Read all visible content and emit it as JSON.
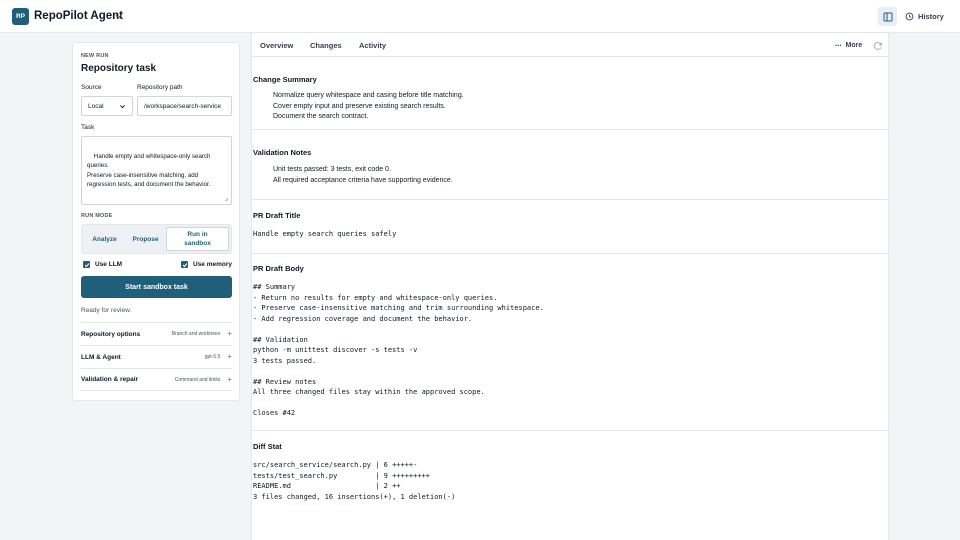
{
  "app": {
    "logo": "RP",
    "title": "RepoPilot Agent",
    "chevron_icon": "chevron-down-icon"
  },
  "header": {
    "panel_toggle_icon": "sidebar-panel-icon",
    "history_icon": "history-clock-icon",
    "history_label": "History"
  },
  "form": {
    "eyebrow": "NEW RUN",
    "title": "Repository task",
    "source_label": "Source",
    "source_value": "Local",
    "repo_label": "Repository path",
    "repo_value": "/workspace/search-service",
    "task_label": "Task",
    "task_value": "Handle empty and whitespace-only search queries.\nPreserve case-insensitive matching, add regression tests, and document the behavior.",
    "run_mode_label": "RUN MODE",
    "run_modes": [
      {
        "label": "Analyze",
        "active": false
      },
      {
        "label": "Propose",
        "active": false
      },
      {
        "label": "Run in sandbox",
        "active": true
      }
    ],
    "use_llm_label": "Use LLM",
    "use_llm_checked": true,
    "use_memory_label": "Use memory",
    "use_memory_checked": true,
    "start_button": "Start sandbox task",
    "status": "Ready for review.",
    "options": [
      {
        "title": "Repository options",
        "detail": "Branch and worktrees"
      },
      {
        "title": "LLM & Agent",
        "detail": "gpt-5.5"
      },
      {
        "title": "Validation & repair",
        "detail": "Command and limits"
      }
    ]
  },
  "tabs": [
    "Overview",
    "Changes",
    "Activity"
  ],
  "more_label": "More",
  "change_summary": {
    "title": "Change Summary",
    "items": [
      "Normalize query whitespace and casing before title matching.",
      "Cover empty input and preserve existing search results.",
      "Document the search contract."
    ]
  },
  "validation_notes": {
    "title": "Validation Notes",
    "items": [
      "Unit tests passed: 3 tests, exit code 0.",
      "All required acceptance criteria have supporting evidence."
    ]
  },
  "pr_title": {
    "title": "PR Draft Title",
    "value": "Handle empty search queries safely"
  },
  "pr_body": {
    "title": "PR Draft Body",
    "value": "## Summary\n- Return no results for empty and whitespace-only queries.\n- Preserve case-insensitive matching and trim surrounding whitespace.\n- Add regression coverage and document the behavior.\n\n## Validation\npython -m unittest discover -s tests -v\n3 tests passed.\n\n## Review notes\nAll three changed files stay within the approved scope.\n\nCloses #42"
  },
  "diff_stat": {
    "title": "Diff Stat",
    "value": "src/search_service/search.py | 6 +++++-\ntests/test_search.py         | 9 +++++++++\nREADME.md                    | 2 ++\n3 files changed, 16 insertions(+), 1 deletion(-)"
  },
  "colors": {
    "accent": "#1f5f7a",
    "border": "#e5e7eb",
    "background": "#f3f4f6"
  }
}
